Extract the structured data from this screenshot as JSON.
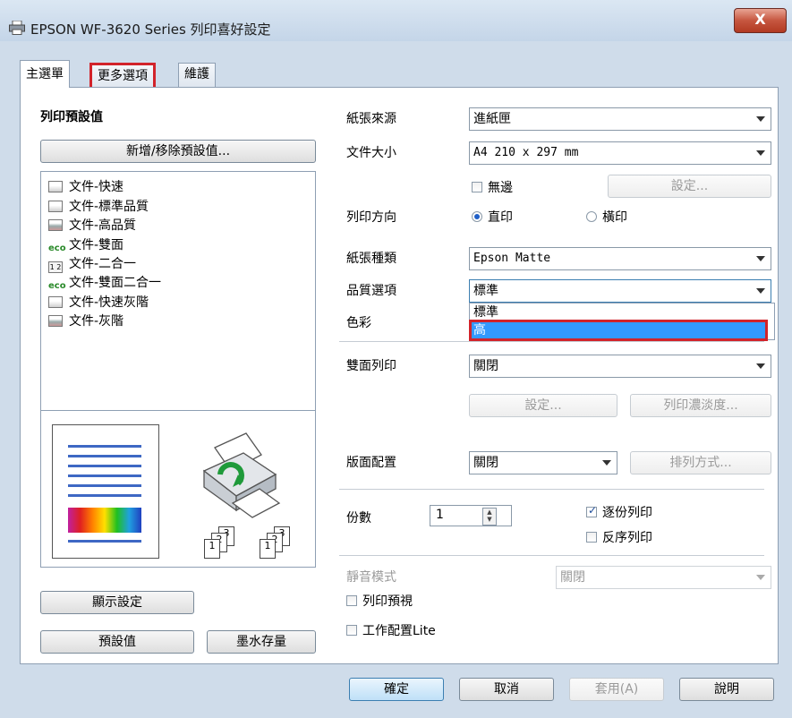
{
  "window": {
    "title": "EPSON WF-3620 Series 列印喜好設定",
    "close_label": "X"
  },
  "tabs": [
    "主選單",
    "更多選項",
    "維護"
  ],
  "presets": {
    "heading": "列印預設值",
    "add_remove_button": "新增/移除預設值...",
    "items": [
      {
        "label": "文件-快速",
        "icon": "document-icon"
      },
      {
        "label": "文件-標準品質",
        "icon": "document-icon"
      },
      {
        "label": "文件-高品質",
        "icon": "document-color-icon"
      },
      {
        "label": "文件-雙面",
        "icon": "eco-icon"
      },
      {
        "label": "文件-二合一",
        "icon": "two-in-one-icon"
      },
      {
        "label": "文件-雙面二合一",
        "icon": "eco-icon"
      },
      {
        "label": "文件-快速灰階",
        "icon": "document-icon"
      },
      {
        "label": "文件-灰階",
        "icon": "document-color-icon"
      }
    ]
  },
  "preview": {
    "collate_stack_1": [
      "1",
      "2",
      "3"
    ],
    "collate_stack_2": [
      "1",
      "2",
      "3"
    ]
  },
  "left_buttons": {
    "show_settings": "顯示設定",
    "defaults": "預設值",
    "ink_levels": "墨水存量"
  },
  "settings": {
    "paper_source": {
      "label": "紙張來源",
      "value": "進紙匣"
    },
    "document_size": {
      "label": "文件大小",
      "value": "A4 210 x 297 mm"
    },
    "borderless": {
      "label": "無邊",
      "checked": false
    },
    "borderless_settings_button": "設定...",
    "orientation": {
      "label": "列印方向",
      "portrait": "直印",
      "landscape": "橫印",
      "selected": "直印"
    },
    "paper_type": {
      "label": "紙張種類",
      "value": "Epson Matte"
    },
    "quality": {
      "label": "品質選項",
      "value": "標準",
      "options": [
        "標準",
        "高"
      ],
      "highlighted": "高"
    },
    "color": {
      "label": "色彩"
    },
    "duplex": {
      "label": "雙面列印",
      "value": "關閉",
      "settings_button": "設定...",
      "density_button": "列印濃淡度..."
    },
    "layout": {
      "label": "版面配置",
      "value": "關閉",
      "arrange_button": "排列方式..."
    },
    "copies": {
      "label": "份數",
      "value": "1"
    },
    "collate": {
      "label": "逐份列印",
      "checked": true
    },
    "reverse": {
      "label": "反序列印",
      "checked": false
    },
    "quiet_mode": {
      "label": "靜音模式",
      "value": "關閉"
    },
    "print_preview": {
      "label": "列印預視",
      "checked": false
    },
    "job_arranger": {
      "label": "工作配置Lite",
      "checked": false
    }
  },
  "footer": {
    "ok": "確定",
    "cancel": "取消",
    "apply": "套用(A)",
    "help": "說明"
  },
  "colors": {
    "highlight_red": "#d2232a",
    "selection_blue": "#3399ff",
    "title_bar": "#cfdcea"
  }
}
